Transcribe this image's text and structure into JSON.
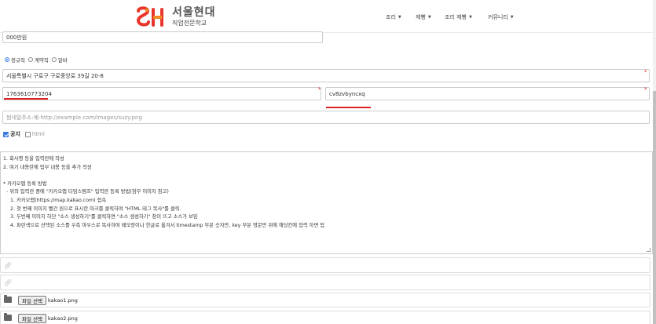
{
  "header": {
    "logo_title": "서울현대",
    "logo_subtitle": "직업전문학교",
    "nav": [
      {
        "label": "조리"
      },
      {
        "label": "제빵"
      },
      {
        "label": "조리 제빵"
      },
      {
        "label": "커뮤니티"
      }
    ]
  },
  "form": {
    "salary_value": "000만원",
    "employment_types": [
      {
        "label": "정규직",
        "selected": true
      },
      {
        "label": "계약직",
        "selected": false
      },
      {
        "label": "알바",
        "selected": false
      }
    ],
    "address_value": "서울특별시 구로구 구로중앙로 39길 20-8",
    "place_id_value": "1763610773204",
    "key_value": "cv8zvbyncxq",
    "thumbnail_placeholder": "썸네일주소:예-http://example.com/images/suzy.png",
    "notice_label": "공지",
    "html_label": "html",
    "notice_checked": true,
    "html_checked": false,
    "content_lines": [
      "1. 회사명 등을 입력란에 작성",
      "2. 여기 내용란에 업무 내용 등을 추가 작성",
      "",
      "* 카카오맵 등록 방법",
      "- 위의 입력란 중에 \"카카오맵 타임스탬프\" 입력란 등록 방법(첨부 이미지 참고)",
      "1. 카카오맵(https://map.kakao.com) 접속",
      "2. 첫 번째 이미지 빨간 원으로 표시한 마크를 클릭하여 \"HTML 태그 복사\"를 클릭.",
      "3. 두번째 이미지 하단 \"소스 생성하기\"를 클릭하면 \"소스 생성하기\" 창이 뜨고 소스가 보임",
      "4. 파란색으로 선택된 소스를 우측 마우스로 복사하여 메모장이나 한글로 옮겨서 timestamp 부분 숫자만, key 부분 영문만 위에 해당칸에 입력 하면 됨"
    ],
    "file_button_label": "파일 선택",
    "files": [
      "kakao1.png",
      "kakao2.png"
    ]
  },
  "icons": {
    "link": "link-icon",
    "folder": "folder-icon"
  },
  "colors": {
    "required": "#e0201f",
    "accent": "#3b7be0",
    "logo_red": "#e8362c",
    "logo_orange": "#f08a24"
  }
}
